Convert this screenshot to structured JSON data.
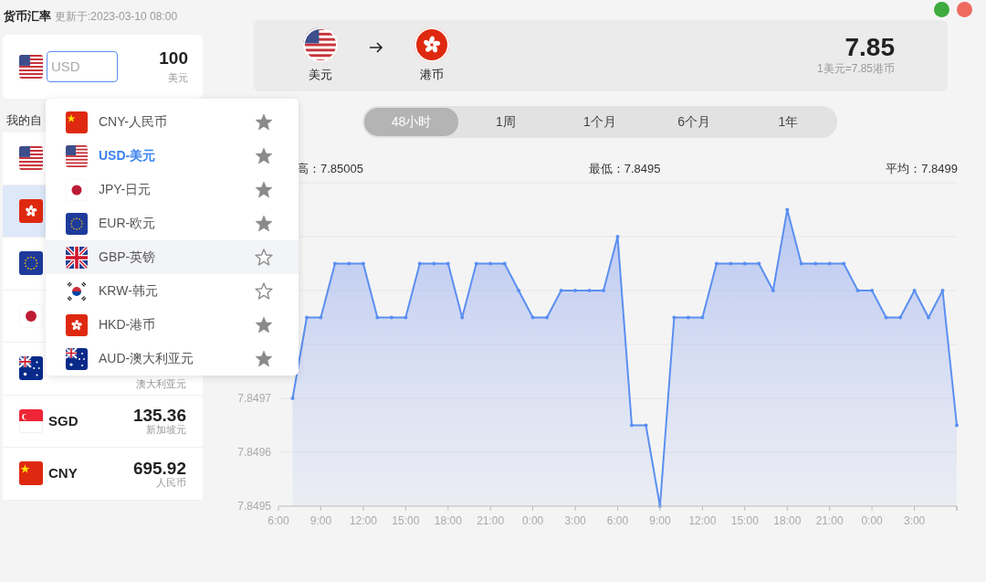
{
  "app": {
    "title": "货币汇率",
    "updated": "更新于:2023-03-10 08:00"
  },
  "window_controls": [
    {
      "color": "#3dab3d"
    },
    {
      "color": "#ee6a5f"
    }
  ],
  "converter": {
    "kind": "us",
    "input": {
      "placeholder": "USD",
      "focused": true
    },
    "amount": "100",
    "unit": "美元"
  },
  "watchlist": {
    "title": "我的自",
    "rows": [
      {
        "kind": "us",
        "selected": false
      },
      {
        "kind": "hk",
        "selected": true
      },
      {
        "kind": "eu",
        "selected": false
      },
      {
        "kind": "jp",
        "selected": false
      },
      {
        "kind": "au",
        "name": "澳大利亚元",
        "selected": false
      },
      {
        "kind": "sg",
        "code": "SGD",
        "amount": "135.36",
        "name": "新加坡元",
        "selected": false
      },
      {
        "kind": "cn",
        "code": "CNY",
        "amount": "695.92",
        "name": "人民币",
        "selected": false
      }
    ]
  },
  "dropdown": {
    "items": [
      {
        "kind": "cn",
        "label": "CNY-人民币",
        "favorite": true,
        "selected": false,
        "hovered": false
      },
      {
        "kind": "us",
        "label": "USD-美元",
        "favorite": true,
        "selected": true,
        "hovered": false
      },
      {
        "kind": "jp",
        "label": "JPY-日元",
        "favorite": true,
        "selected": false,
        "hovered": false
      },
      {
        "kind": "eu",
        "label": "EUR-欧元",
        "favorite": true,
        "selected": false,
        "hovered": false
      },
      {
        "kind": "gb",
        "label": "GBP-英镑",
        "favorite": false,
        "selected": false,
        "hovered": true
      },
      {
        "kind": "kr",
        "label": "KRW-韩元",
        "favorite": false,
        "selected": false,
        "hovered": false
      },
      {
        "kind": "hk",
        "label": "HKD-港币",
        "favorite": true,
        "selected": false,
        "hovered": false
      },
      {
        "kind": "au",
        "label": "AUD-澳大利亚元",
        "favorite": true,
        "selected": false,
        "hovered": false
      }
    ]
  },
  "pair": {
    "from": {
      "kind": "us",
      "name": "美元"
    },
    "to": {
      "kind": "hk",
      "name": "港币"
    },
    "rate": "7.85",
    "formula": "1美元=7.85港币"
  },
  "ranges": [
    {
      "label": "48小时",
      "selected": true
    },
    {
      "label": "1周",
      "selected": false
    },
    {
      "label": "1个月",
      "selected": false
    },
    {
      "label": "6个月",
      "selected": false
    },
    {
      "label": "1年",
      "selected": false
    }
  ],
  "stats": [
    "高：7.85005",
    "最低：7.8495",
    "平均：7.8499"
  ],
  "chart": {
    "chart_data": {
      "type": "area",
      "categories": [
        "6:00",
        null,
        null,
        "9:00",
        null,
        null,
        "12:00",
        null,
        null,
        "15:00",
        null,
        null,
        "18:00",
        null,
        null,
        "21:00",
        null,
        null,
        "0:00",
        null,
        null,
        "3:00",
        null,
        null,
        "6:00",
        null,
        null,
        "9:00",
        null,
        null,
        "12:00",
        null,
        null,
        "15:00",
        null,
        null,
        "18:00",
        null,
        null,
        "21:00",
        null,
        null,
        "0:00",
        null,
        null,
        "3:00",
        null,
        null,
        null
      ],
      "series": [
        {
          "color": "#5b8ff0",
          "values": [
            null,
            7.8497,
            7.84985,
            7.84985,
            7.84995,
            7.84995,
            7.84995,
            7.84985,
            7.84985,
            7.84985,
            7.84995,
            7.84995,
            7.84995,
            7.84985,
            7.84995,
            7.84995,
            7.84995,
            7.8499,
            7.84985,
            7.84985,
            7.8499,
            7.8499,
            7.8499,
            7.8499,
            7.85,
            7.84965,
            7.84965,
            7.8495,
            7.84985,
            7.84985,
            7.84985,
            7.84995,
            7.84995,
            7.84995,
            7.84995,
            7.8499,
            7.85005,
            7.84995,
            7.84995,
            7.84995,
            7.84995,
            7.8499,
            7.8499,
            7.84985,
            7.84985,
            7.8499,
            7.84985,
            7.8499,
            7.84965
          ]
        }
      ],
      "ylim": [
        7.8495,
        7.8501
      ],
      "yticks": [
        7.8495,
        7.8496,
        7.8497
      ]
    }
  }
}
